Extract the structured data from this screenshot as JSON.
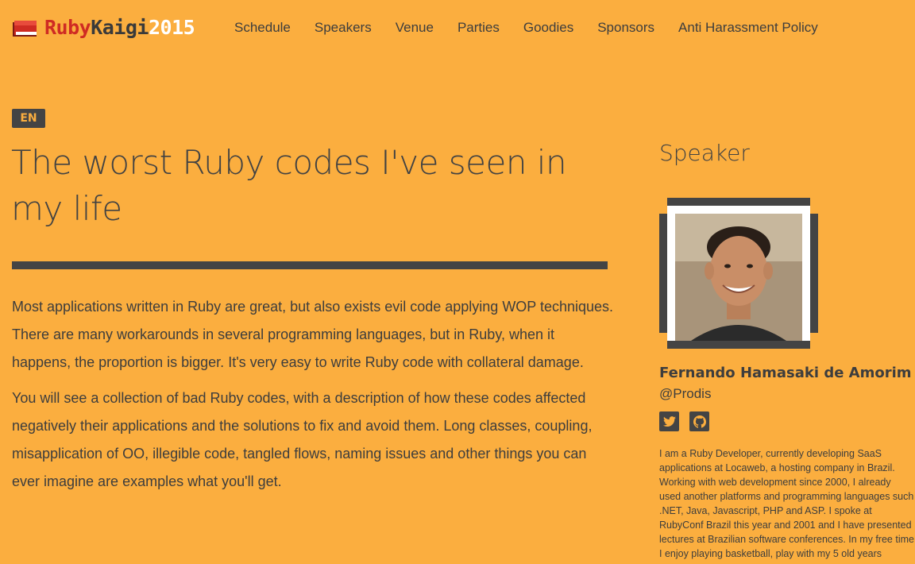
{
  "header": {
    "logo": {
      "ruby": "Ruby",
      "kaigi": "Kaigi",
      "year": "2015"
    },
    "nav": [
      "Schedule",
      "Speakers",
      "Venue",
      "Parties",
      "Goodies",
      "Sponsors",
      "Anti Harassment Policy"
    ]
  },
  "talk": {
    "language": "EN",
    "title": "The worst Ruby codes I've seen in my life",
    "paragraphs": [
      "Most applications written in Ruby are great, but also exists evil code applying WOP techniques. There are many workarounds in several programming languages, but in Ruby, when it happens, the proportion is bigger. It's very easy to write Ruby code with collateral damage.",
      "You will see a collection of bad Ruby codes, with a description of how these codes affected negatively their applications and the solutions to fix and avoid them. Long classes, coupling, misapplication of OO, illegible code, tangled flows, naming issues and other things you can ever imagine are examples what you'll get."
    ]
  },
  "sidebar": {
    "heading": "Speaker",
    "name": "Fernando Hamasaki de Amorim",
    "handle": "@Prodis",
    "social_icons": [
      "twitter-icon",
      "github-icon"
    ],
    "bio": "I am a Ruby Developer, currently developing SaaS applications at Locaweb, a hosting company in Brazil. Working with web development since 2000, I already used another platforms and programming languages such .NET, Java, Javascript, PHP and ASP. I spoke at RubyConf Brazil this year and 2001 and I have presented lectures at Brazilian software conferences. In my free time I enjoy playing basketball, play with my 5 old years"
  },
  "colors": {
    "background": "#FBAE3F",
    "dark": "#444444",
    "logo_red": "#cf2b23",
    "logo_white": "#ffffff"
  }
}
